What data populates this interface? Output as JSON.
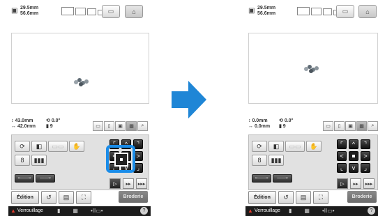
{
  "colors": {
    "accent": "#1a8ce8",
    "arrow": "#1f86d6",
    "status_warn": "#e23b2b"
  },
  "before": {
    "dims": {
      "width": "29.5mm",
      "height": "56.6mm"
    },
    "position": {
      "x": "43.0mm",
      "y": "42.0mm"
    },
    "rotation": "0.0°",
    "colors_count": "9",
    "edit_label": "Édition",
    "embroider_label": "Broderie",
    "lock_label": "Verrouillage"
  },
  "after": {
    "dims": {
      "width": "29.5mm",
      "height": "56.6mm"
    },
    "position": {
      "x": "0.0mm",
      "y": "0.0mm"
    },
    "rotation": "0.0°",
    "colors_count": "9",
    "edit_label": "Édition",
    "embroider_label": "Broderie",
    "lock_label": "Verrouillage"
  },
  "icons": {
    "hoop": "hoop-icon",
    "home": "home-icon",
    "rotate": "rotate-icon",
    "center": "center-icon",
    "arrow": "right-arrow-icon"
  }
}
